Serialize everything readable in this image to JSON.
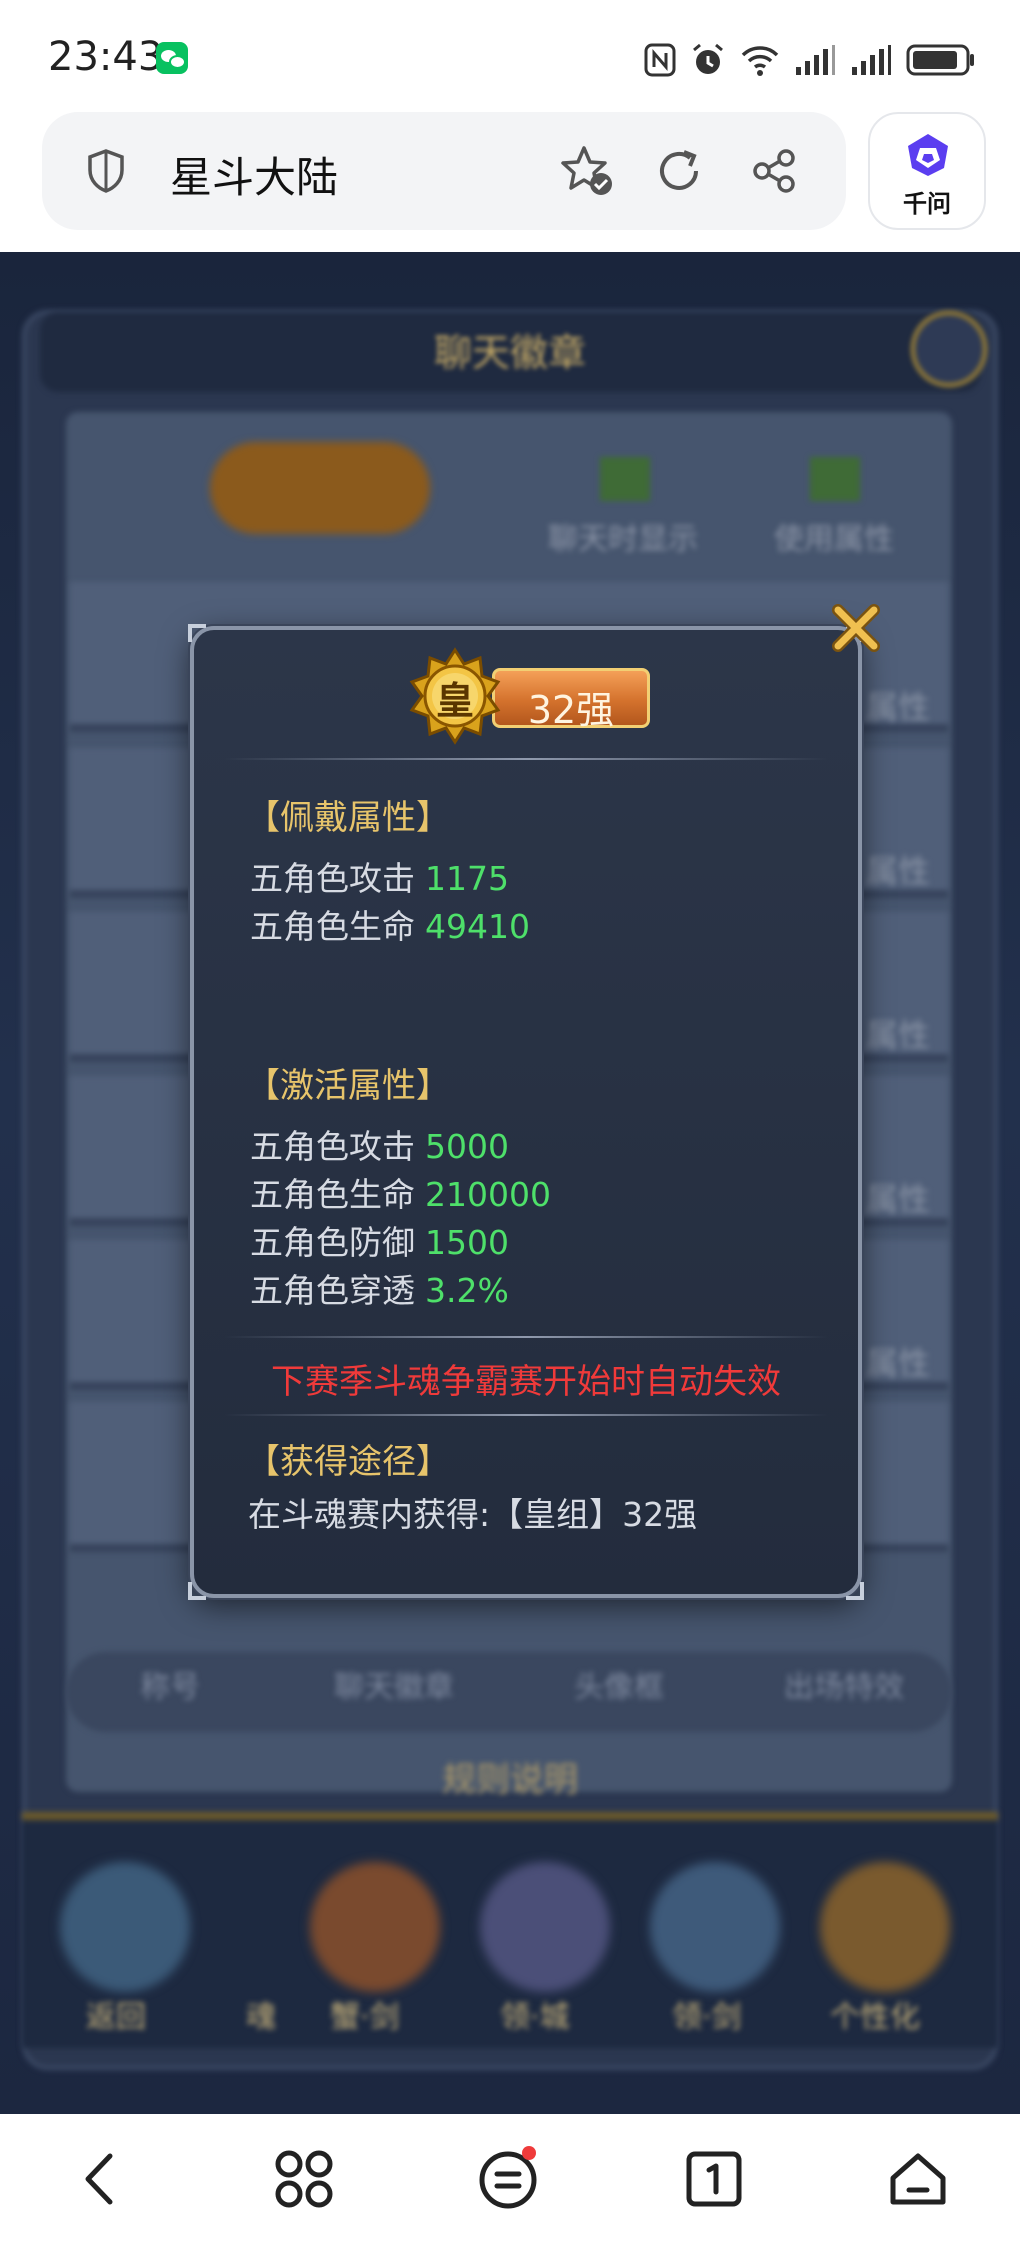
{
  "status_bar": {
    "time": "23:43"
  },
  "browser": {
    "page_title": "星斗大陆",
    "assistant_label": "千问"
  },
  "background": {
    "header_title": "聊天徽章",
    "option_1": "聊天时显示",
    "option_2": "使用属性",
    "row_label": "属性",
    "tabs": [
      "称号",
      "聊天徽章",
      "头像框",
      "出场特效"
    ],
    "rules_link": "规则说明",
    "bottom_items": [
      "返回",
      "魂",
      "蟹·剑",
      "领·城",
      "领·剑",
      "个性化"
    ]
  },
  "modal": {
    "badge_glyph": "皇",
    "badge_rank": "32强",
    "wear_section_title": "【佩戴属性】",
    "wear_attrs": [
      {
        "label": "五角色攻击",
        "value": "1175"
      },
      {
        "label": "五角色生命",
        "value": "49410"
      }
    ],
    "active_section_title": "【激活属性】",
    "active_attrs": [
      {
        "label": "五角色攻击",
        "value": "5000"
      },
      {
        "label": "五角色生命",
        "value": "210000"
      },
      {
        "label": "五角色防御",
        "value": "1500"
      },
      {
        "label": "五角色穿透",
        "value": "3.2%"
      }
    ],
    "warning": "下赛季斗魂争霸赛开始时自动失效",
    "source_section_title": "【获得途径】",
    "source_text": "在斗魂赛内获得:【皇组】32强"
  },
  "colors": {
    "modal_bg": "#262f41",
    "section_title": "#e7c46b",
    "attr_value": "#4ee06a",
    "warning": "#f03a3a",
    "close_gold": "#e6b54a"
  }
}
